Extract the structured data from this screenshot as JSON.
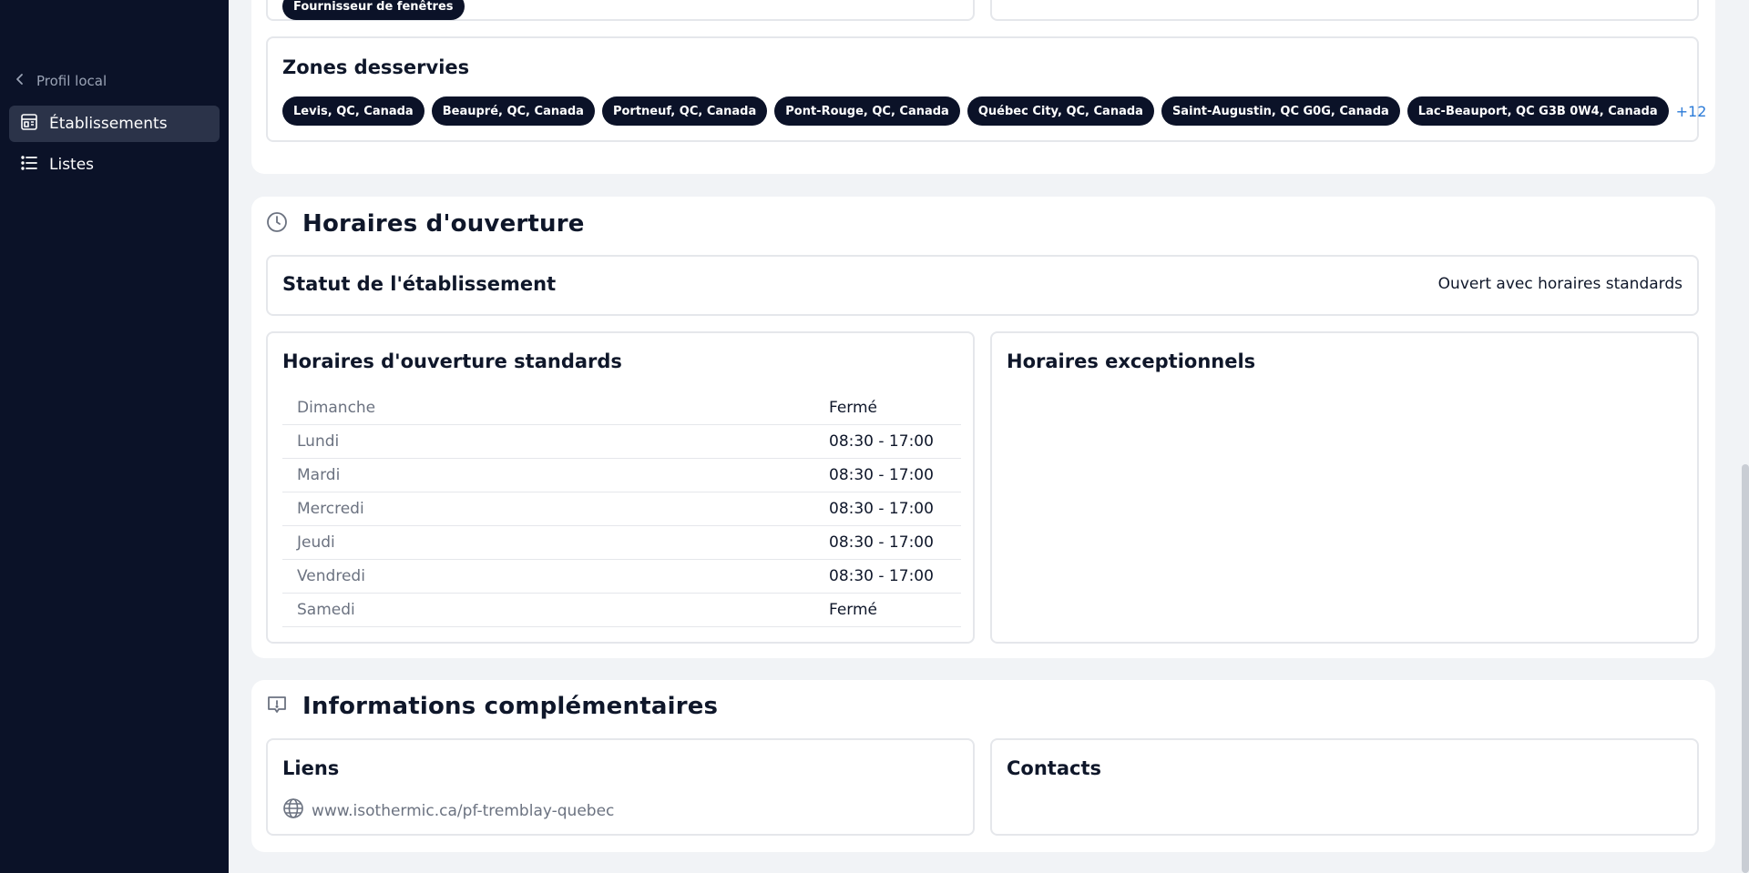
{
  "sidebar": {
    "back_label": "Profil local",
    "items": [
      {
        "label": "Établissements",
        "icon": "building-icon",
        "active": true
      },
      {
        "label": "Listes",
        "icon": "list-icon",
        "active": false
      }
    ]
  },
  "top_card": {
    "category_pill": "Fournisseur de fenêtres"
  },
  "zones": {
    "title": "Zones desservies",
    "items": [
      "Levis, QC, Canada",
      "Beaupré, QC, Canada",
      "Portneuf, QC, Canada",
      "Pont-Rouge, QC, Canada",
      "Québec City, QC, Canada",
      "Saint-Augustin, QC G0G, Canada",
      "Lac-Beauport, QC G3B 0W4, Canada"
    ],
    "more_label": "+12"
  },
  "opening_hours": {
    "title": "Horaires d'ouverture",
    "status": {
      "label": "Statut de l'établissement",
      "value": "Ouvert avec horaires standards"
    },
    "standard": {
      "title": "Horaires d'ouverture standards",
      "rows": [
        {
          "day": "Dimanche",
          "hours": "Fermé"
        },
        {
          "day": "Lundi",
          "hours": "08:30 - 17:00"
        },
        {
          "day": "Mardi",
          "hours": "08:30 - 17:00"
        },
        {
          "day": "Mercredi",
          "hours": "08:30 - 17:00"
        },
        {
          "day": "Jeudi",
          "hours": "08:30 - 17:00"
        },
        {
          "day": "Vendredi",
          "hours": "08:30 - 17:00"
        },
        {
          "day": "Samedi",
          "hours": "Fermé"
        }
      ]
    },
    "exceptional": {
      "title": "Horaires exceptionnels"
    }
  },
  "additional_info": {
    "title": "Informations complémentaires",
    "links": {
      "title": "Liens",
      "url": "www.isothermic.ca/pf-tremblay-quebec"
    },
    "contacts": {
      "title": "Contacts"
    }
  },
  "colors": {
    "sidebar_bg": "#0b1228",
    "sidebar_active": "#2b3349",
    "page_bg": "#f1f3f6",
    "pill_bg": "#0b1228",
    "accent_link": "#2b7bd8",
    "muted_text": "#6b7280"
  }
}
